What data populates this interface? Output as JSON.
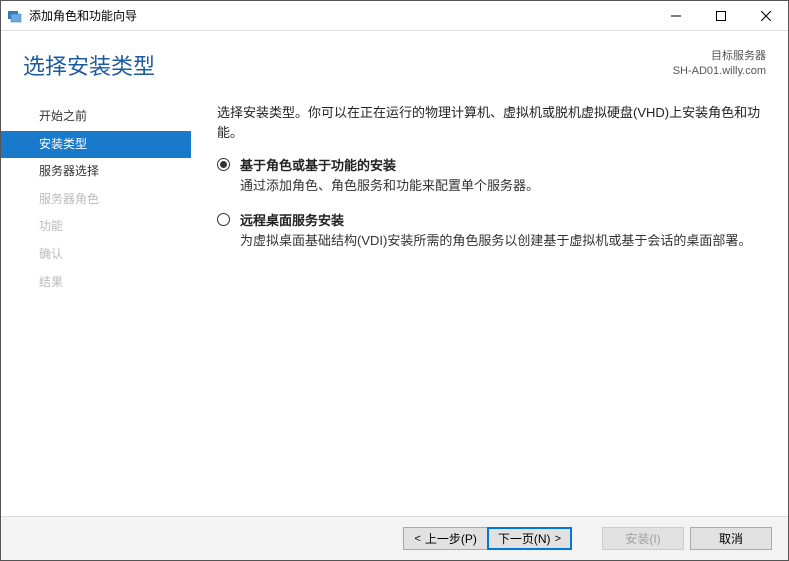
{
  "window": {
    "title": "添加角色和功能向导"
  },
  "header": {
    "title": "选择安装类型",
    "dest_label": "目标服务器",
    "dest_value": "SH-AD01.willy.com"
  },
  "sidebar": {
    "items": [
      {
        "label": "开始之前",
        "state": "normal"
      },
      {
        "label": "安装类型",
        "state": "active"
      },
      {
        "label": "服务器选择",
        "state": "normal"
      },
      {
        "label": "服务器角色",
        "state": "disabled"
      },
      {
        "label": "功能",
        "state": "disabled"
      },
      {
        "label": "确认",
        "state": "disabled"
      },
      {
        "label": "结果",
        "state": "disabled"
      }
    ]
  },
  "content": {
    "intro": "选择安装类型。你可以在正在运行的物理计算机、虚拟机或脱机虚拟硬盘(VHD)上安装角色和功能。",
    "options": [
      {
        "title": "基于角色或基于功能的安装",
        "desc": "通过添加角色、角色服务和功能来配置单个服务器。",
        "selected": true
      },
      {
        "title": "远程桌面服务安装",
        "desc": "为虚拟桌面基础结构(VDI)安装所需的角色服务以创建基于虚拟机或基于会话的桌面部署。",
        "selected": false
      }
    ]
  },
  "footer": {
    "prev": "上一步(P)",
    "next": "下一页(N)",
    "install": "安装(I)",
    "cancel": "取消"
  }
}
